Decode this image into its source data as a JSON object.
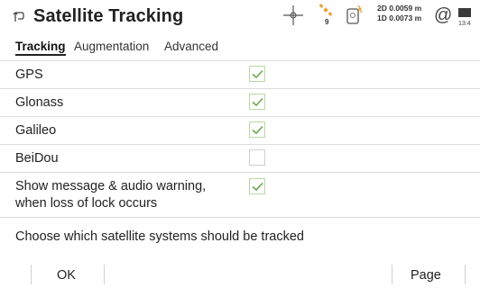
{
  "header": {
    "title": "Satellite Tracking",
    "satellite_count": "9",
    "precision_2d": "2D 0.0059 m",
    "precision_1d": "1D 0.0073 m",
    "at_symbol": "@",
    "clock": "13:4",
    "icons": [
      "back-arrow-icon",
      "position-target-icon",
      "satellite-icon",
      "receiver-icon",
      "at-icon",
      "battery-icon"
    ]
  },
  "tabs": [
    {
      "label": "Tracking",
      "active": true
    },
    {
      "label": "Augmentation",
      "active": false
    },
    {
      "label": "Advanced",
      "active": false
    }
  ],
  "systems": [
    {
      "label": "GPS",
      "checked": true
    },
    {
      "label": "Glonass",
      "checked": true
    },
    {
      "label": "Galileo",
      "checked": true
    },
    {
      "label": "BeiDou",
      "checked": false
    }
  ],
  "warning": {
    "line1": "Show message & audio warning,",
    "line2": "when loss of lock occurs",
    "checked": true
  },
  "helper_text": "Choose which satellite systems should be tracked",
  "footer": {
    "ok_label": "OK",
    "page_label": "Page"
  },
  "colors": {
    "check": "#6aa84f",
    "check_border": "#b9d9a4",
    "sat_icon": "#e8a33a"
  }
}
